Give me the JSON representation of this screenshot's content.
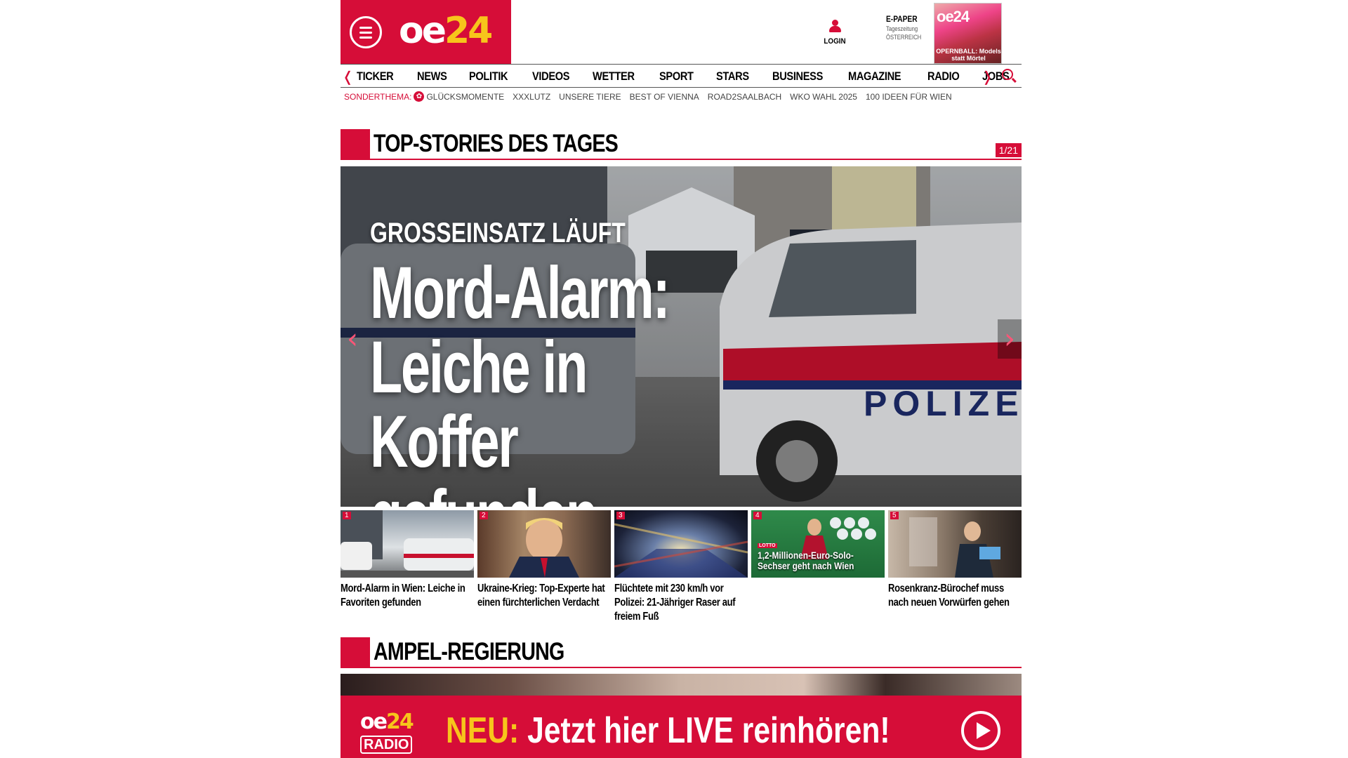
{
  "header": {
    "logo_main": "oe",
    "logo_num": "24",
    "login_label": "LOGIN",
    "epaper_title": "E-PAPER",
    "epaper_sub1": "Tageszeitung",
    "epaper_sub2": "ÖSTERREICH",
    "epaper_cover_logo": "oe24",
    "epaper_cover_headline": "OPERNBALL: Models statt Mörtel"
  },
  "nav": {
    "items": [
      "TICKER",
      "NEWS",
      "POLITIK",
      "VIDEOS",
      "WETTER",
      "SPORT",
      "STARS",
      "BUSINESS",
      "MAGAZINE",
      "RADIO",
      "JOBS"
    ],
    "left_arrow": "❬",
    "right_arrow": "❭"
  },
  "subnav": {
    "lead": "SONDERTHEMA:",
    "items": [
      "GLÜCKSMOMENTE",
      "XXXLUTZ",
      "UNSERE TIERE",
      "BEST OF VIENNA",
      "ROAD2SAALBACH",
      "WKO WAHL 2025",
      "100 IDEEN FÜR WIEN"
    ]
  },
  "top_stories": {
    "title": "TOP-STORIES DES TAGES",
    "counter": "1/21",
    "hero": {
      "kicker": "GROSSEINSATZ LÄUFT",
      "headline": "Mord-Alarm: Leiche in Koffer gefunden"
    },
    "thumbs": [
      {
        "num": "1",
        "caption": "Mord-Alarm in Wien: Leiche in Favoriten gefunden"
      },
      {
        "num": "2",
        "caption": "Ukraine-Krieg: Top-Experte hat einen fürchterlichen Verdacht"
      },
      {
        "num": "3",
        "caption": "Flüchtete mit 230 km/h vor Polizei: 21-Jähriger Raser auf freiem Fuß"
      },
      {
        "num": "4",
        "caption": "",
        "overlay": "1,2-Millionen-Euro-Solo-Sechser geht nach Wien",
        "tag": "LOTTO"
      },
      {
        "num": "5",
        "caption": "Rosenkranz-Bürochef muss nach neuen Vorwürfen gehen"
      }
    ]
  },
  "section2": {
    "title": "AMPEL-REGIERUNG"
  },
  "radio_banner": {
    "logo_top": "oe",
    "logo_num": "24",
    "logo_bottom": "RADIO",
    "neu": "NEU:",
    "text": "Jetzt hier LIVE reinhören!"
  },
  "colors": {
    "brand_red": "#d60d38",
    "brand_yellow": "#f7c51b"
  }
}
